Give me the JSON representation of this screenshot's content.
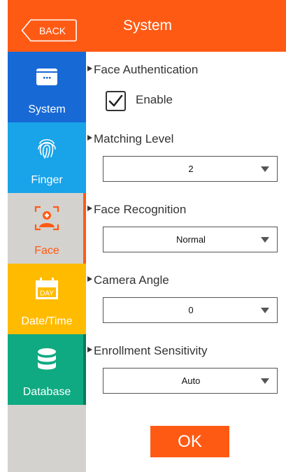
{
  "header": {
    "back_label": "BACK",
    "title": "System"
  },
  "sidebar": {
    "items": [
      {
        "label": "System",
        "color": "#1769d6",
        "edge": "#1769d6",
        "icon": "screen-icon"
      },
      {
        "label": "Finger",
        "color": "#19a3e8",
        "edge": "#19a3e8",
        "icon": "fingerprint-icon"
      },
      {
        "label": "Face",
        "color": "#d4d2cf",
        "edge": "#ff5a14",
        "icon": "face-scan-icon"
      },
      {
        "label": "Date/Time",
        "color": "#ffbb00",
        "edge": "#ffbb00",
        "icon": "calendar-icon",
        "icon_text": "DAY"
      },
      {
        "label": "Database",
        "color": "#0faa82",
        "edge": "#0a7a5c",
        "icon": "database-icon"
      }
    ]
  },
  "main": {
    "face_auth": {
      "title": "Face Authentication",
      "enable_label": "Enable",
      "checked": true
    },
    "matching_level": {
      "title": "Matching Level",
      "value": "2"
    },
    "face_recognition": {
      "title": "Face Recognition",
      "value": "Normal"
    },
    "camera_angle": {
      "title": "Camera Angle",
      "value": "0"
    },
    "enrollment_sensitivity": {
      "title": "Enrollment Sensitivity",
      "value": "Auto"
    },
    "ok_label": "OK"
  },
  "colors": {
    "accent": "#ff5a14"
  }
}
